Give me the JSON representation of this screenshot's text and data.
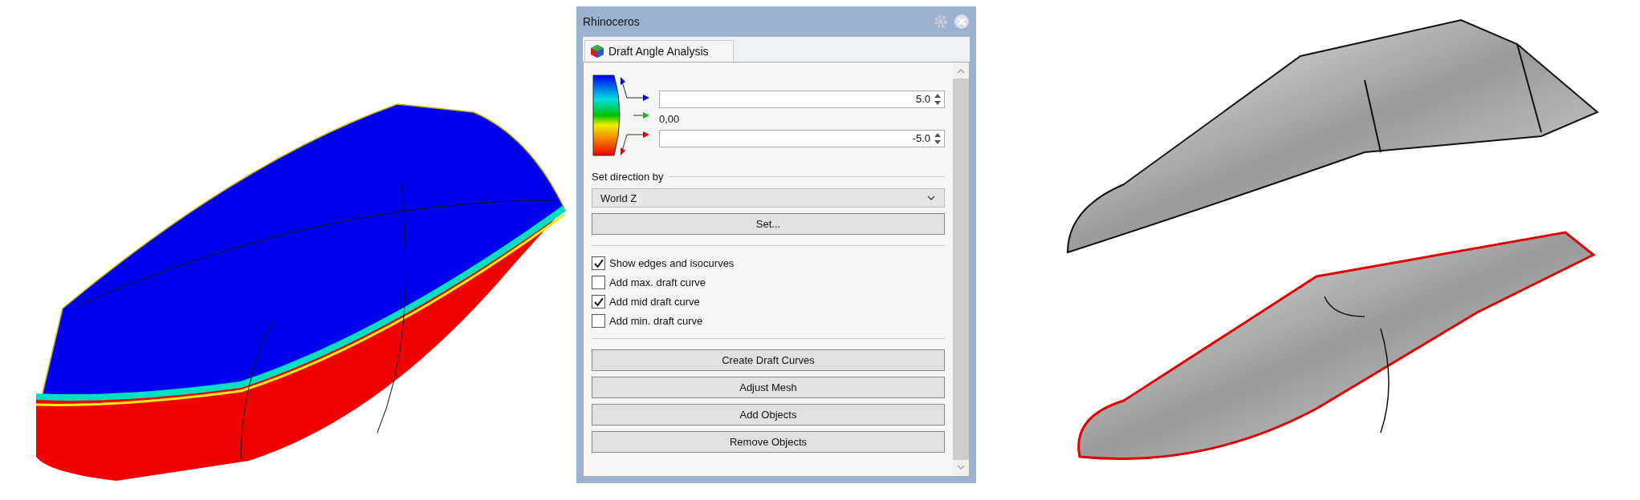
{
  "window": {
    "title": "Rhinoceros"
  },
  "tabs": [
    {
      "label": "Draft Angle Analysis",
      "selected": true
    }
  ],
  "range": {
    "upper": "5.0",
    "middle": "0,00",
    "lower": "-5.0"
  },
  "direction": {
    "label": "Set direction by",
    "value": "World Z",
    "button": "Set..."
  },
  "options": [
    {
      "label": "Show edges and isocurves",
      "checked": true
    },
    {
      "label": "Add max. draft curve",
      "checked": false
    },
    {
      "label": "Add mid draft curve",
      "checked": true
    },
    {
      "label": "Add min. draft curve",
      "checked": false
    }
  ],
  "buttons": [
    "Create Draft Curves",
    "Adjust Mesh",
    "Add Objects",
    "Remove Objects"
  ]
}
